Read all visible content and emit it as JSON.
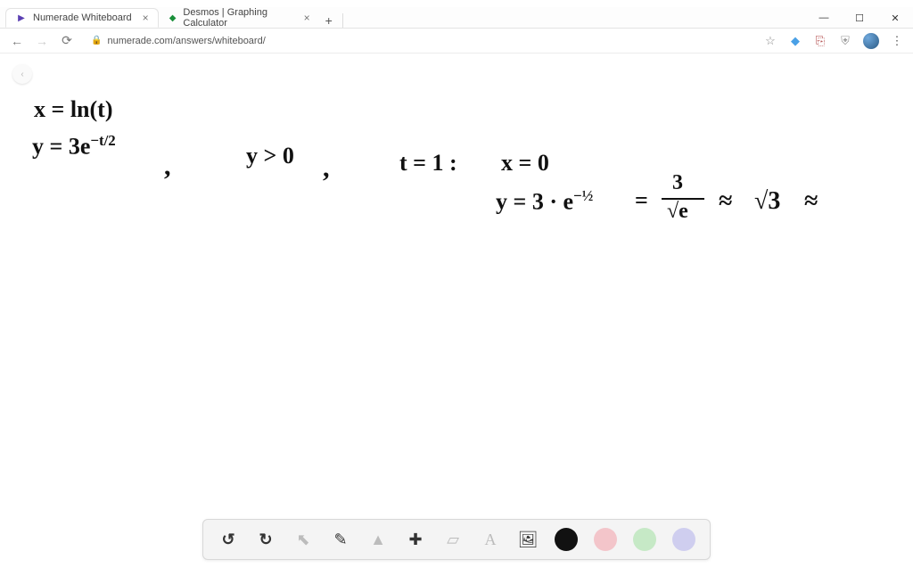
{
  "window": {
    "minimize": "—",
    "maximize": "☐",
    "close": "✕"
  },
  "tabs": [
    {
      "title": "Numerade Whiteboard",
      "favicon": "▶",
      "favcolor": "#5b3fb3",
      "active": true
    },
    {
      "title": "Desmos | Graphing Calculator",
      "favicon": "◆",
      "favcolor": "#1a8f3a",
      "active": false
    }
  ],
  "newtab": "+",
  "nav": {
    "back": "←",
    "forward": "→",
    "reload": "⟳"
  },
  "omnibox": {
    "lock": "🔒",
    "url": "numerade.com/answers/whiteboard/"
  },
  "right_icons": {
    "star": "☆",
    "gem": "◆",
    "pdf": "⎘",
    "shield": "⛨",
    "menu": "⋮"
  },
  "small_btn": "‹",
  "handwriting": {
    "l1": "x = ln(t)",
    "l2a": "y = 3e",
    "l2b": "−t/2",
    "comma1": ",",
    "cond": "y > 0",
    "comma2": ",",
    "tval": "t = 1 :",
    "x0": "x = 0",
    "y3e_a": "y = 3 · e",
    "y3e_b": "−½",
    "eq": "=",
    "frac_num": "3",
    "frac_den": "√e",
    "approx1": "≈",
    "sqrt3": "√3",
    "approx2": "≈"
  },
  "toolbar": {
    "undo": "↺",
    "redo": "↻",
    "select": "⬉",
    "pen": "✎",
    "shapes": "▲",
    "plus": "✚",
    "eraser": "▱",
    "text": "A",
    "image": "🖼"
  },
  "colors": {
    "black": "#111111",
    "pink": "#f3c5ca",
    "green": "#c6e9c6",
    "purple": "#cfceef"
  }
}
